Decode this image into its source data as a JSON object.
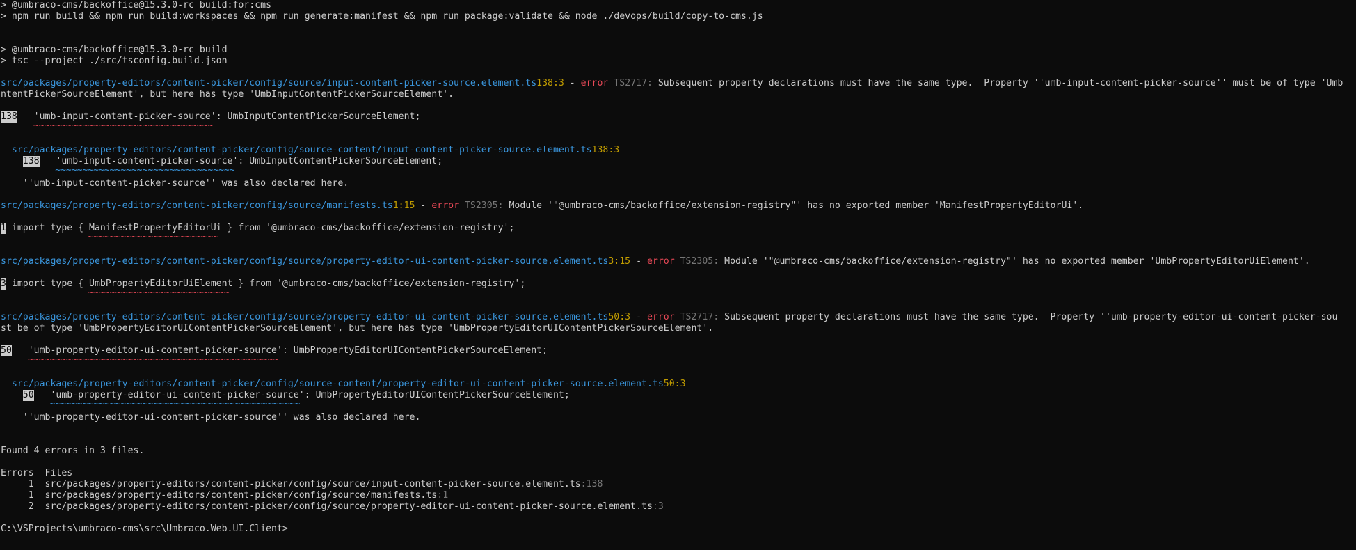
{
  "cmd1": "> @umbraco-cms/backoffice@15.3.0-rc build:for:cms",
  "cmd2": "> npm run build && npm run build:workspaces && npm run generate:manifest && npm run package:validate && node ./devops/build/copy-to-cms.js",
  "cmd3": "> @umbraco-cms/backoffice@15.3.0-rc build",
  "cmd4": "> tsc --project ./src/tsconfig.build.json",
  "errors": [
    {
      "path": "src/packages/property-editors/content-picker/config/source/input-content-picker-source.element.ts",
      "loc": "138:3",
      "sep": " - ",
      "kind": "error",
      "code": " TS2717: ",
      "message": "Subsequent property declarations must have the same type.  Property ''umb-input-content-picker-source'' must be of type 'Umb",
      "message2": "ntentPickerSourceElement', but here has type 'UmbInputContentPickerSourceElement'.",
      "lnum": "138",
      "code_line": "   'umb-input-content-picker-source': UmbInputContentPickerSourceElement;",
      "squig": "~~~~~~~~~~~~~~~~~~~~~~~~~~~~~~~~~",
      "related_path": "src/packages/property-editors/content-picker/config/source-content/input-content-picker-source.element.ts",
      "related_loc": "138:3",
      "related_lnum": "138",
      "related_code": "   'umb-input-content-picker-source': UmbInputContentPickerSourceElement;",
      "related_squig": "~~~~~~~~~~~~~~~~~~~~~~~~~~~~~~~~~",
      "related_note": "''umb-input-content-picker-source'' was also declared here."
    },
    {
      "path": "src/packages/property-editors/content-picker/config/source/manifests.ts",
      "loc": "1:15",
      "sep": " - ",
      "kind": "error",
      "code": " TS2305: ",
      "message": "Module '\"@umbraco-cms/backoffice/extension-registry\"' has no exported member 'ManifestPropertyEditorUi'.",
      "lnum": "1",
      "code_line": " import type { ManifestPropertyEditorUi } from '@umbraco-cms/backoffice/extension-registry';",
      "squig": "~~~~~~~~~~~~~~~~~~~~~~~~"
    },
    {
      "path": "src/packages/property-editors/content-picker/config/source/property-editor-ui-content-picker-source.element.ts",
      "loc": "3:15",
      "sep": " - ",
      "kind": "error",
      "code": " TS2305: ",
      "message": "Module '\"@umbraco-cms/backoffice/extension-registry\"' has no exported member 'UmbPropertyEditorUiElement'.",
      "lnum": "3",
      "code_line": " import type { UmbPropertyEditorUiElement } from '@umbraco-cms/backoffice/extension-registry';",
      "squig": "~~~~~~~~~~~~~~~~~~~~~~~~~~"
    },
    {
      "path": "src/packages/property-editors/content-picker/config/source/property-editor-ui-content-picker-source.element.ts",
      "loc": "50:3",
      "sep": " - ",
      "kind": "error",
      "code": " TS2717: ",
      "message": "Subsequent property declarations must have the same type.  Property ''umb-property-editor-ui-content-picker-sou",
      "message2": "st be of type 'UmbPropertyEditorUIContentPickerSourceElement', but here has type 'UmbPropertyEditorUIContentPickerSourceElement'.",
      "lnum": "50",
      "code_line": "   'umb-property-editor-ui-content-picker-source': UmbPropertyEditorUIContentPickerSourceElement;",
      "squig": "~~~~~~~~~~~~~~~~~~~~~~~~~~~~~~~~~~~~~~~~~~~~~~",
      "related_path": "src/packages/property-editors/content-picker/config/source-content/property-editor-ui-content-picker-source.element.ts",
      "related_loc": "50:3",
      "related_lnum": "50",
      "related_code": "   'umb-property-editor-ui-content-picker-source': UmbPropertyEditorUIContentPickerSourceElement;",
      "related_squig": "~~~~~~~~~~~~~~~~~~~~~~~~~~~~~~~~~~~~~~~~~~~~~~",
      "related_note": "''umb-property-editor-ui-content-picker-source'' was also declared here."
    }
  ],
  "summary": "Found 4 errors in 3 files.",
  "table_header": "Errors  Files",
  "table_rows": [
    {
      "count": "     1  ",
      "file": "src/packages/property-editors/content-picker/config/source/input-content-picker-source.element.ts",
      "line": ":138"
    },
    {
      "count": "     1  ",
      "file": "src/packages/property-editors/content-picker/config/source/manifests.ts",
      "line": ":1"
    },
    {
      "count": "     2  ",
      "file": "src/packages/property-editors/content-picker/config/source/property-editor-ui-content-picker-source.element.ts",
      "line": ":3"
    }
  ],
  "prompt": "C:\\VSProjects\\umbraco-cms\\src\\Umbraco.Web.UI.Client>",
  "colors": {
    "background": "#0c0c0c",
    "text": "#cccccc",
    "path": "#3a96dd",
    "location": "#c19c00",
    "error": "#e74856",
    "code": "#767676"
  }
}
